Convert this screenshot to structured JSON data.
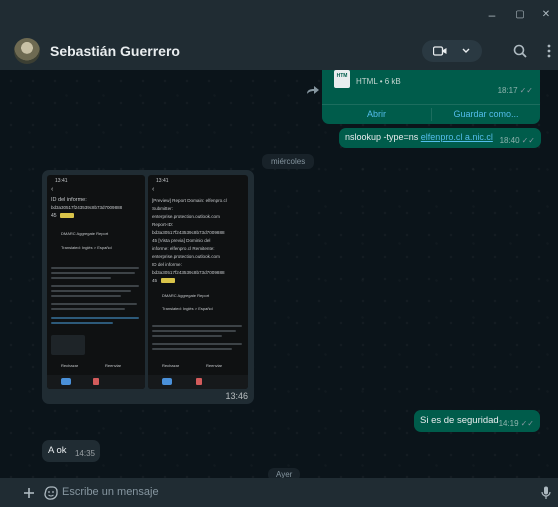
{
  "window": {
    "minimize_glyph": "–",
    "maximize_glyph": "▢",
    "close_glyph": "✕"
  },
  "header": {
    "contact_name": "Sebastián Guerrero",
    "icons": [
      "video-camera-icon",
      "chevron-down-icon",
      "search-icon",
      "menu-icon"
    ]
  },
  "messages": {
    "file": {
      "file_type": "HTM",
      "file_info": "HTML • 6 kB",
      "time": "18:17",
      "open_label": "Abrir",
      "save_label": "Guardar como..."
    },
    "nslookup": {
      "prefix": "nslookup -type=ns ",
      "link": "elfenpro.cl a.nic.cl",
      "time": "18:40"
    },
    "day_divider_1": "miércoles",
    "image_time": "13:46",
    "security": {
      "text": "Si es de seguridad",
      "time": "14:19"
    },
    "aok": {
      "text": "A ok",
      "time": "14:35"
    },
    "day_divider_2": "Ayer"
  },
  "screenshots": {
    "left": {
      "time": "13:41",
      "lines": [
        "ID del informe:",
        "bd3a30517f243539c8b73d7009888",
        "45",
        "DMARC Aggregate Report",
        "Translated: Inglés > Español",
        "Rechazar",
        "Reenviar"
      ]
    },
    "right": {
      "time": "13:41",
      "lines": [
        "[Preview] Report Domain: elfenpro.cl",
        "Submitter:",
        "enterprise.protection.outlook.com",
        "Report-ID:",
        "bd3a30517f243539c8b73d7009888",
        "45 [Vista previa] Dominio del",
        "informe: elfenpro.cl Remitente:",
        "enterprise.protection.outlook.com",
        "ID del informe:",
        "bd3a30517f243539c8b73d7009888",
        "45",
        "DMARC Aggregate Report",
        "Translated: Inglés > Español",
        "Rechazar",
        "Reenviar"
      ]
    }
  },
  "composer": {
    "placeholder": "Escribe un mensaje"
  }
}
